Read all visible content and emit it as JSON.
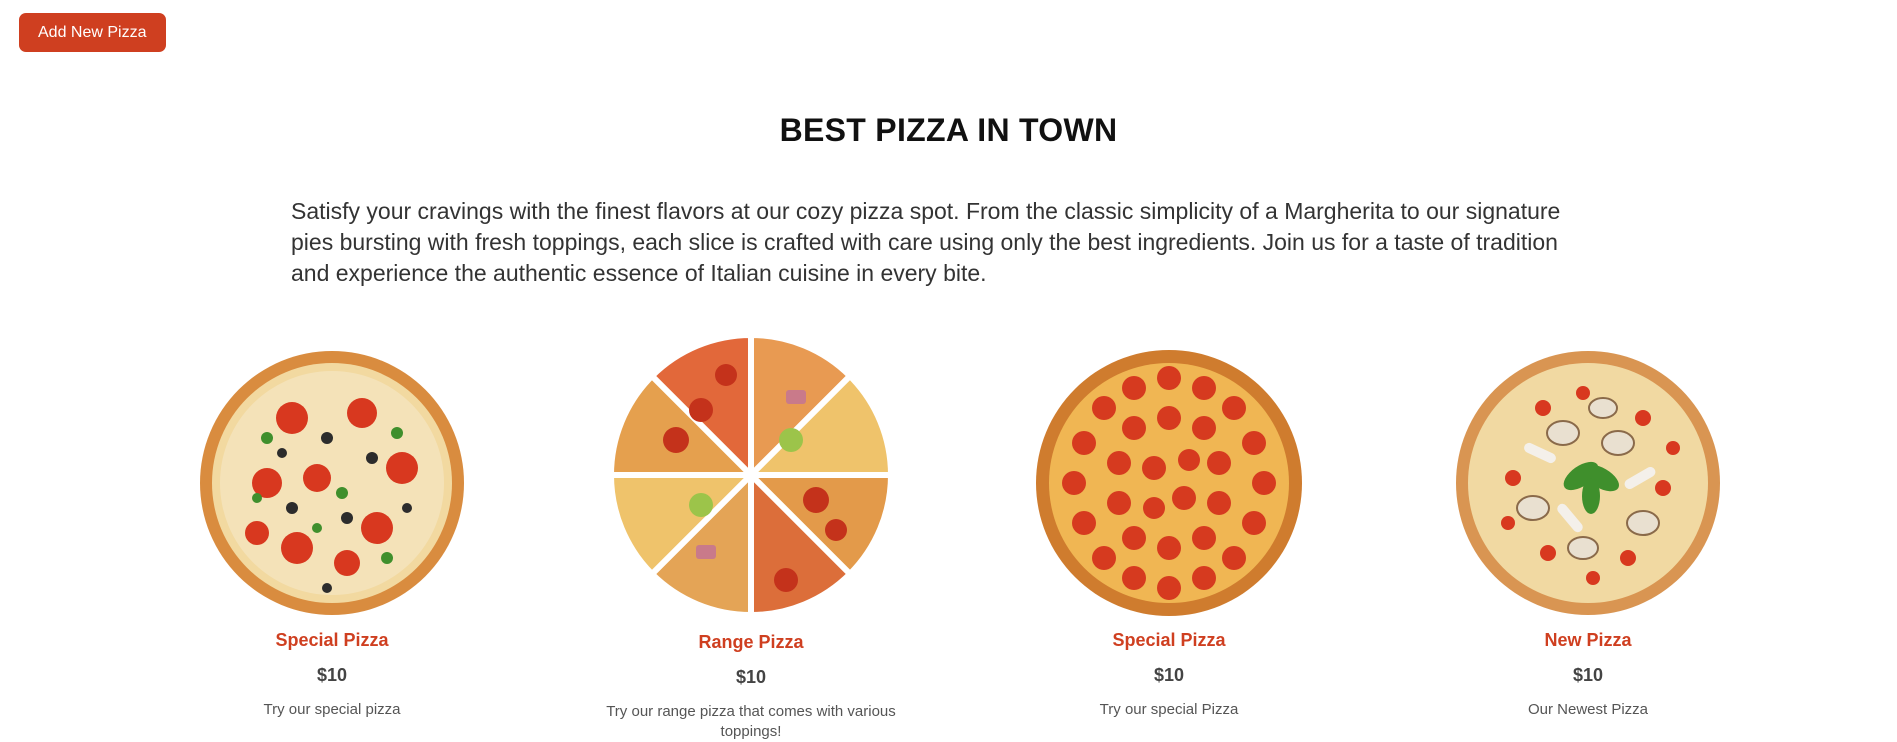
{
  "toolbar": {
    "add_label": "Add New Pizza"
  },
  "hero": {
    "title": "BEST PIZZA IN TOWN",
    "intro": "Satisfy your cravings with the finest flavors at our cozy pizza spot. From the classic simplicity of a Margherita to our signature pies bursting with fresh toppings, each slice is crafted with care using only the best ingredients. Join us for a taste of tradition and experience the authentic essence of Italian cuisine in every bite."
  },
  "pizzas": [
    {
      "name": "Special Pizza",
      "price": "$10",
      "description": "Try our special pizza",
      "image": "veggie-pizza-image"
    },
    {
      "name": "Range Pizza",
      "price": "$10",
      "description": "Try our range pizza that comes with various toppings!",
      "image": "sliced-mixed-pizza-image"
    },
    {
      "name": "Special Pizza",
      "price": "$10",
      "description": "Try our special Pizza",
      "image": "pepperoni-pizza-image"
    },
    {
      "name": "New Pizza",
      "price": "$10",
      "description": "Our Newest Pizza",
      "image": "mushroom-pizza-image"
    }
  ],
  "colors": {
    "accent": "#cf3f20",
    "crust": "#d98c3f",
    "cheese": "#f2d37a",
    "sauce": "#d8381f"
  }
}
